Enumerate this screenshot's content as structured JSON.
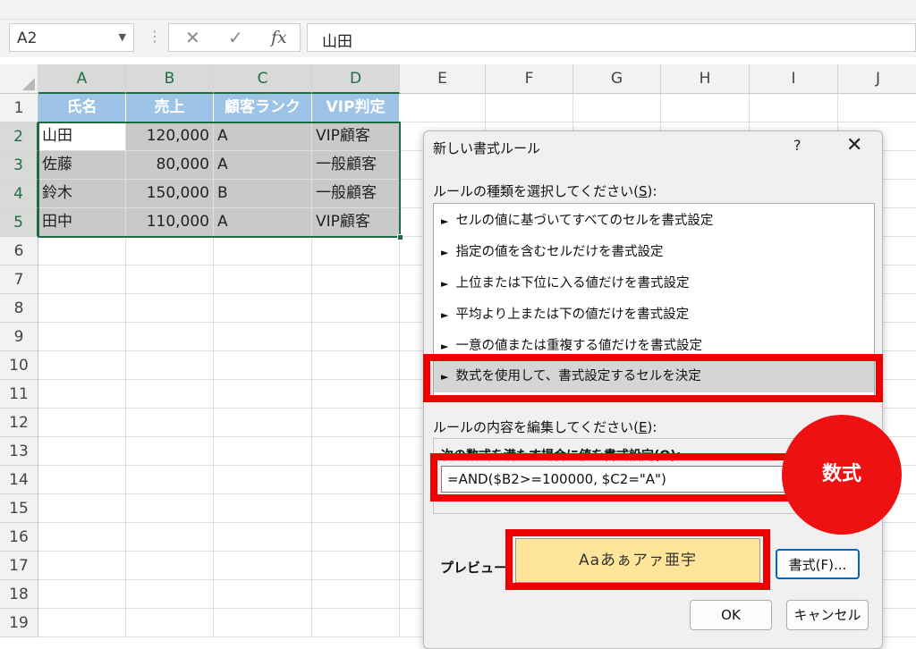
{
  "formula_bar": {
    "name_box": "A2",
    "cancel_icon": "✕",
    "enter_icon": "✓",
    "fx_label": "fx",
    "content": "山田"
  },
  "sheet": {
    "columns": [
      "A",
      "B",
      "C",
      "D",
      "E",
      "F",
      "G",
      "H",
      "I",
      "J"
    ],
    "rows": [
      "1",
      "2",
      "3",
      "4",
      "5",
      "6",
      "7",
      "8",
      "9",
      "10",
      "11",
      "12",
      "13",
      "14",
      "15",
      "16",
      "17",
      "18",
      "19"
    ],
    "header_row": [
      "氏名",
      "売上",
      "顧客ランク",
      "VIP判定"
    ],
    "data": [
      [
        "山田",
        "120,000",
        "A",
        "VIP顧客"
      ],
      [
        "佐藤",
        "80,000",
        "A",
        "一般顧客"
      ],
      [
        "鈴木",
        "150,000",
        "B",
        "一般顧客"
      ],
      [
        "田中",
        "110,000",
        "A",
        "VIP顧客"
      ]
    ],
    "colors": {
      "header_fill": "#9dc3e6",
      "selection_fill": "#c9c9c9",
      "selection_border": "#1f6e43"
    }
  },
  "dialog": {
    "title": "新しい書式ルール",
    "help": "?",
    "close": "✕",
    "rule_type_label": "ルールの種類を選択してください(",
    "rule_type_key": "S",
    "rule_type_suffix": "):",
    "rules": [
      "セルの値に基づいてすべてのセルを書式設定",
      "指定の値を含むセルだけを書式設定",
      "上位または下位に入る値だけを書式設定",
      "平均より上または下の値だけを書式設定",
      "一意の値または重複する値だけを書式設定",
      "数式を使用して、書式設定するセルを決定"
    ],
    "rule_bullet": "►",
    "edit_label": "ルールの内容を編集してください(",
    "edit_key": "E",
    "edit_suffix": "):",
    "formula_sublabel": "次の数式を満たす場合に値を書式設定(O):",
    "formula_value": "=AND($B2>=100000, $C2=\"A\")",
    "preview_label": "プレビュー:",
    "preview_sample": "Aaあぁアァ亜宇",
    "format_button": "書式(F)...",
    "ok_button": "OK",
    "cancel_button": "キャンセル",
    "colors": {
      "preview_fill": "#ffe599",
      "selected_rule": "#d5d5d5"
    }
  },
  "annotation": {
    "badge_text": "数式",
    "color": "#ee0000"
  }
}
